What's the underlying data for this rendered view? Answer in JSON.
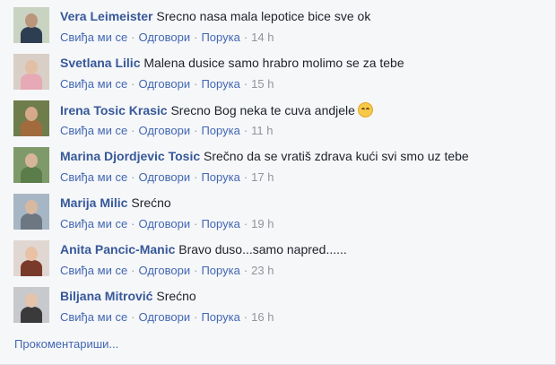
{
  "comments": [
    {
      "author": "Vera Leimeister",
      "text": "Srecno nasa mala lepotice bice sve ok",
      "like": "Свиђа ми се",
      "reply": "Одговори",
      "message": "Порука",
      "time": "14 h",
      "avatar": {
        "bg": "#c9d3c1",
        "skin": "#b9967c",
        "shirt": "#2d3d52",
        "icon": "user-photo-icon"
      }
    },
    {
      "author": "Svetlana Lilic",
      "text": "Malena dusice samo hrabro molimo se za tebe",
      "like": "Свиђа ми се",
      "reply": "Одговори",
      "message": "Порука",
      "time": "15 h",
      "avatar": {
        "bg": "#d9cfc6",
        "skin": "#e3bfa6",
        "shirt": "#e7a9b5",
        "icon": "user-photo-icon"
      }
    },
    {
      "author": "Irena Tosic Krasic",
      "text": "Srecno Bog neka te cuva andjele",
      "like": "Свиђа ми се",
      "reply": "Одговори",
      "message": "Порука",
      "time": "11 h",
      "avatar": {
        "bg": "#6f7d4c",
        "skin": "#d6a98a",
        "shirt": "#a26b3d",
        "icon": "user-photo-icon"
      }
    },
    {
      "author": "Marina Djordjevic Tosic",
      "text": "Srečno da se vratiš zdrava kući svi smo uz tebe",
      "like": "Свиђа ми се",
      "reply": "Одговори",
      "message": "Порука",
      "time": "17 h",
      "avatar": {
        "bg": "#7f9a6a",
        "skin": "#d7b59b",
        "shirt": "#5b7d4a",
        "icon": "user-photo-icon"
      }
    },
    {
      "author": "Marija Milic",
      "text": "Srećno",
      "like": "Свиђа ми се",
      "reply": "Одговори",
      "message": "Порука",
      "time": "19 h",
      "avatar": {
        "bg": "#a7b6c4",
        "skin": "#d9b8a0",
        "shirt": "#6d7782",
        "icon": "user-photo-icon"
      }
    },
    {
      "author": "Anita Pancic-Manic",
      "text": "Bravo duso...samo napred......",
      "like": "Свиђа ми се",
      "reply": "Одговори",
      "message": "Порука",
      "time": "23 h",
      "avatar": {
        "bg": "#e0d7d3",
        "skin": "#e9c2a6",
        "shirt": "#7a3a2a",
        "icon": "user-photo-icon"
      }
    },
    {
      "author": "Biljana Mitrović",
      "text": "Srećno",
      "like": "Свиђа ми се",
      "reply": "Одговори",
      "message": "Порука",
      "time": "16 h",
      "avatar": {
        "bg": "#c7c9cc",
        "skin": "#e6c3ab",
        "shirt": "#3a3a3a",
        "icon": "user-photo-icon"
      }
    }
  ],
  "emoji": {
    "index": 2,
    "icon": "grinning-emoji-icon"
  },
  "more_comments": "Прокоментариши..."
}
